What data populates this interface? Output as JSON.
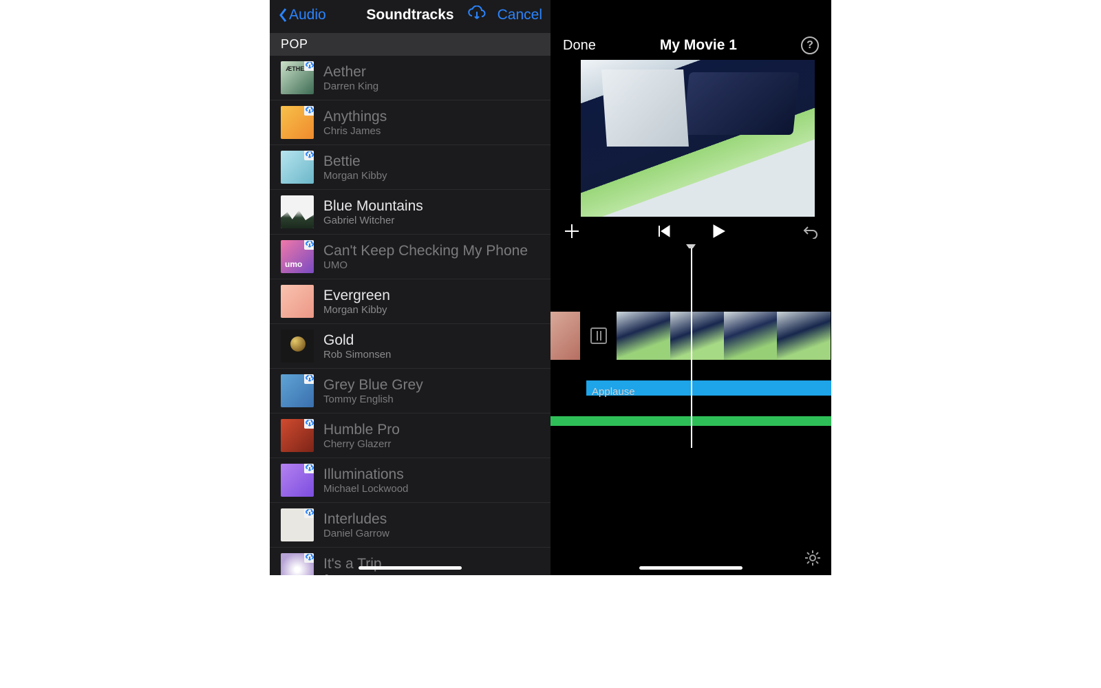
{
  "left": {
    "nav": {
      "back_label": "Audio",
      "title": "Soundtracks",
      "cancel_label": "Cancel"
    },
    "section_header": "POP",
    "tracks": [
      {
        "title": "Aether",
        "artist": "Darren King",
        "art": "g0",
        "cloud": true,
        "dim": true
      },
      {
        "title": "Anythings",
        "artist": "Chris James",
        "art": "g1",
        "cloud": true,
        "dim": true
      },
      {
        "title": "Bettie",
        "artist": "Morgan Kibby",
        "art": "g2",
        "cloud": true,
        "dim": true
      },
      {
        "title": "Blue Mountains",
        "artist": "Gabriel Witcher",
        "art": "g3",
        "cloud": false,
        "dim": false
      },
      {
        "title": "Can't Keep Checking My Phone",
        "artist": "UMO",
        "art": "g4",
        "cloud": true,
        "dim": true
      },
      {
        "title": "Evergreen",
        "artist": "Morgan Kibby",
        "art": "g5",
        "cloud": false,
        "dim": false
      },
      {
        "title": "Gold",
        "artist": "Rob Simonsen",
        "art": "g6",
        "cloud": false,
        "dim": false
      },
      {
        "title": "Grey Blue Grey",
        "artist": "Tommy English",
        "art": "g7",
        "cloud": true,
        "dim": true
      },
      {
        "title": "Humble Pro",
        "artist": "Cherry Glazerr",
        "art": "g8",
        "cloud": true,
        "dim": true
      },
      {
        "title": "Illuminations",
        "artist": "Michael Lockwood",
        "art": "g9",
        "cloud": true,
        "dim": true
      },
      {
        "title": "Interludes",
        "artist": "Daniel Garrow",
        "art": "g10",
        "cloud": true,
        "dim": true
      },
      {
        "title": "It's a Trip",
        "artist": "Joywave",
        "art": "g11",
        "cloud": true,
        "dim": true
      }
    ]
  },
  "right": {
    "nav": {
      "done_label": "Done",
      "title": "My Movie 1",
      "help_label": "?"
    },
    "audio_clip_label": "Applause"
  }
}
